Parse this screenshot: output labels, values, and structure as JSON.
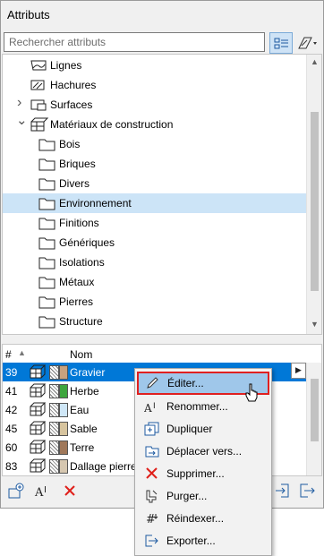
{
  "window": {
    "title": "Attributs"
  },
  "search": {
    "placeholder": "Rechercher attributs"
  },
  "tree": {
    "items": [
      {
        "label": "Lignes"
      },
      {
        "label": "Hachures"
      },
      {
        "label": "Surfaces"
      },
      {
        "label": "Matériaux de construction"
      },
      {
        "label": "Bois"
      },
      {
        "label": "Briques"
      },
      {
        "label": "Divers"
      },
      {
        "label": "Environnement"
      },
      {
        "label": "Finitions"
      },
      {
        "label": "Génériques"
      },
      {
        "label": "Isolations"
      },
      {
        "label": "Métaux"
      },
      {
        "label": "Pierres"
      },
      {
        "label": "Structure"
      }
    ],
    "selected": "Environnement"
  },
  "table": {
    "headers": {
      "num": "#",
      "name": "Nom"
    },
    "rows": [
      {
        "num": "39",
        "name": "Gravier",
        "color": "#c9a27e"
      },
      {
        "num": "41",
        "name": "Herbe",
        "color": "#3ea63e"
      },
      {
        "num": "42",
        "name": "Eau",
        "color": "#cfe7f7"
      },
      {
        "num": "45",
        "name": "Sable",
        "color": "#d7c49e"
      },
      {
        "num": "60",
        "name": "Terre",
        "color": "#a0785a"
      },
      {
        "num": "83",
        "name": "Dallage pierre",
        "color": "#d6c7b0"
      }
    ],
    "selected": "Gravier"
  },
  "context_menu": {
    "items": [
      {
        "label": "Éditer...",
        "icon": "pencil-icon"
      },
      {
        "label": "Renommer...",
        "icon": "rename-icon"
      },
      {
        "label": "Dupliquer",
        "icon": "duplicate-icon"
      },
      {
        "label": "Déplacer vers...",
        "icon": "move-icon"
      },
      {
        "label": "Supprimer...",
        "icon": "delete-icon"
      },
      {
        "label": "Purger...",
        "icon": "purge-icon"
      },
      {
        "label": "Réindexer...",
        "icon": "reindex-icon"
      },
      {
        "label": "Exporter...",
        "icon": "export-icon"
      }
    ],
    "highlighted": "Éditer..."
  },
  "colors": {
    "selection": "#0078d7",
    "tree_selection": "#cce4f7",
    "menu_highlight": "#9fc7ea",
    "highlight_border": "#e02020",
    "delete_red": "#e0201b"
  }
}
